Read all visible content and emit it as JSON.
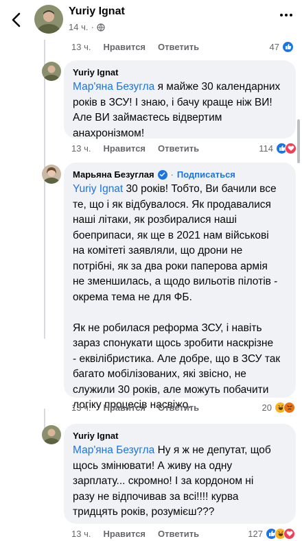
{
  "header": {
    "author": "Yuriy Ignat",
    "time": "14 ч.",
    "dot": "·"
  },
  "top_row": {
    "time": "13 ч.",
    "like": "Нравится",
    "reply": "Ответить",
    "count": "47"
  },
  "comments": [
    {
      "author": "Yuriy Ignat",
      "mention": "Мар'яна Безугла",
      "text": " я майже 30 календарних\nроків в ЗСУ! І знаю, і бачу краще ніж ВИ!\nАле ВИ займаєтесь відвертим\nанахронізмом!",
      "time": "13 ч.",
      "like": "Нравится",
      "reply": "Ответить",
      "count": "114"
    },
    {
      "author": "Марьяна Безуглая",
      "follow": "Подписаться",
      "separator": "·",
      "mention": "Yuriy Ignat",
      "text": " 30 років! Тобто, Ви бачили все\nте, що і як відбувалося. Як продавалися\nнаші літаки, як розбиралися наші\nбоеприпаси, як ще в 2021 нам військові\nна комітеті заявляли, що дрони не\nпотрібні, як за два роки паперова армія\nне зменшилась, а щодо вильотів пілотів -\nокрема тема не для ФБ.\n\nЯк не робилася реформа ЗСУ, і навіть\nзараз спонукати щось зробити наскрізне\n- еквілібристика. Але добре, що в ЗСУ так\nбагато мобілізованих, які звісно, не\nслужили 30 років, але можуть побачити\nлогіку процесів насвіжо.",
      "time": "13 ч.",
      "like": "Нравится",
      "reply": "Ответить",
      "count": "20"
    },
    {
      "author": "Yuriy Ignat",
      "mention": "Мар'яна Безугла",
      "text": " Ну я ж не депутат, щоб\nщось змінювати! А живу на одну\nзарплату... скромно! І за кордоном ні\nразу не відпочивав за всі!!!! курва\nтридцять років, розумієш???",
      "time": "13 ч.",
      "like": "Нравится",
      "reply": "Ответить",
      "count": "127"
    }
  ],
  "colors": {
    "accent": "#1b74e4",
    "bubble": "#f0f2f5",
    "secondary_text": "#65676b"
  }
}
